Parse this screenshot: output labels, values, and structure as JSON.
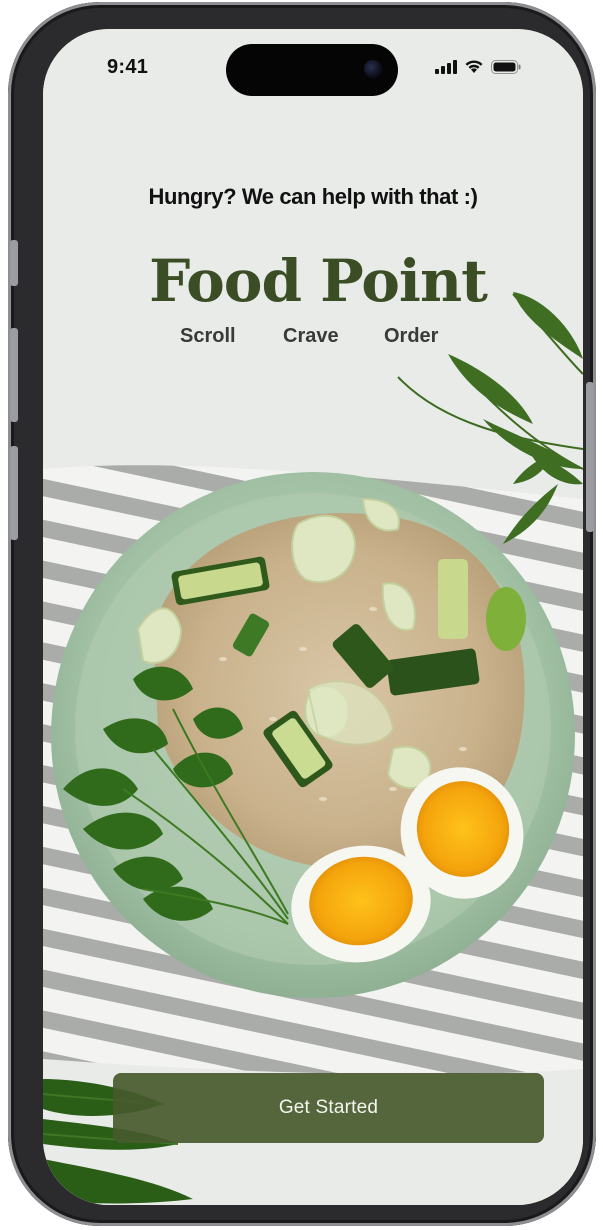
{
  "status_bar": {
    "time": "9:41",
    "icons": [
      "signal-icon",
      "wifi-icon",
      "battery-icon"
    ]
  },
  "hero": {
    "tagline": "Hungry? We can help with that :)",
    "brand": "Food Point",
    "steps": [
      "Scroll",
      "Crave",
      "Order"
    ]
  },
  "cta": {
    "label": "Get Started"
  },
  "colors": {
    "brand": "#3b4d24",
    "button": "#485a2d",
    "background": "#e9ebe9"
  }
}
